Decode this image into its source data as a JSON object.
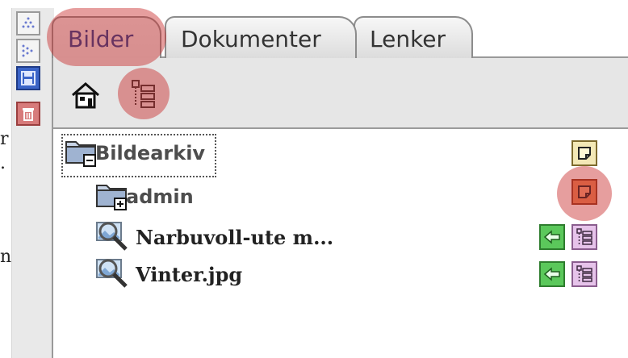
{
  "tabs": [
    {
      "label": "Bilder"
    },
    {
      "label": "Dokumenter"
    },
    {
      "label": "Lenker"
    }
  ],
  "background_text": [
    "r",
    ".",
    "n"
  ],
  "tree": {
    "root": {
      "label": "Bildearkiv",
      "toggle": "−"
    },
    "folder": {
      "label": "admin",
      "toggle": "+"
    },
    "files": [
      {
        "label": "Narbuvoll-ute m..."
      },
      {
        "label": "Vinter.jpg"
      }
    ]
  },
  "icons": {
    "left_toolbar": [
      "triangle-up-dotted-icon",
      "triangle-right-dotted-icon",
      "save-icon",
      "trash-icon"
    ],
    "toolbar": [
      "home-icon",
      "tree-structure-icon"
    ],
    "row_actions": [
      "note-icon",
      "arrow-left-icon",
      "tree-structure-icon"
    ]
  },
  "colors": {
    "active_tab_text": "#1b3c8f",
    "highlight": "#c82828",
    "note_bg": "#f3e8b6",
    "arrow_bg": "#5bc85b",
    "tree_bg": "#e6c3ea"
  }
}
